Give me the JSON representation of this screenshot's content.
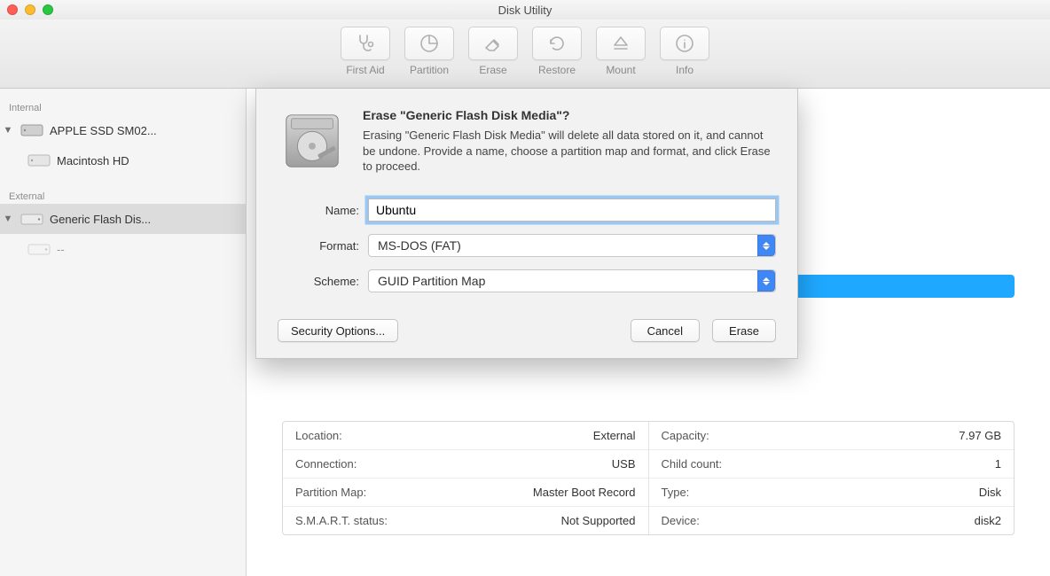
{
  "window": {
    "title": "Disk Utility"
  },
  "toolbar": {
    "first_aid": "First Aid",
    "partition": "Partition",
    "erase": "Erase",
    "restore": "Restore",
    "mount": "Mount",
    "info": "Info"
  },
  "sidebar": {
    "internal_label": "Internal",
    "external_label": "External",
    "internal": [
      {
        "label": "APPLE SSD SM02..."
      },
      {
        "label": "Macintosh HD"
      }
    ],
    "external": [
      {
        "label": "Generic Flash Dis..."
      },
      {
        "label": "--"
      }
    ]
  },
  "dialog": {
    "title": "Erase \"Generic Flash Disk Media\"?",
    "description": "Erasing \"Generic Flash Disk Media\" will delete all data stored on it, and cannot be undone. Provide a name, choose a partition map and format, and click Erase to proceed.",
    "name_label": "Name:",
    "name_value": "Ubuntu",
    "format_label": "Format:",
    "format_value": "MS-DOS (FAT)",
    "scheme_label": "Scheme:",
    "scheme_value": "GUID Partition Map",
    "security_options": "Security Options...",
    "cancel": "Cancel",
    "erase": "Erase"
  },
  "info": {
    "left": [
      {
        "label": "Location:",
        "value": "External"
      },
      {
        "label": "Connection:",
        "value": "USB"
      },
      {
        "label": "Partition Map:",
        "value": "Master Boot Record"
      },
      {
        "label": "S.M.A.R.T. status:",
        "value": "Not Supported"
      }
    ],
    "right": [
      {
        "label": "Capacity:",
        "value": "7.97 GB"
      },
      {
        "label": "Child count:",
        "value": "1"
      },
      {
        "label": "Type:",
        "value": "Disk"
      },
      {
        "label": "Device:",
        "value": "disk2"
      }
    ]
  }
}
